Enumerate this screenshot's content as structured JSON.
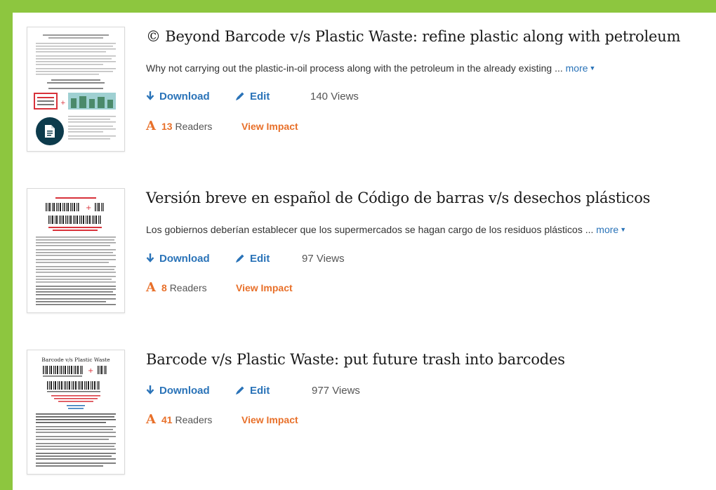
{
  "colors": {
    "background_green": "#8dc63f",
    "link_blue": "#2a73b8",
    "accent_orange": "#e8702a",
    "badge_navy": "#0d3b4c"
  },
  "papers": [
    {
      "title": "© Beyond Barcode v/s Plastic Waste: refine plastic along with petroleum",
      "summary": "Why not carrying out the plastic-in-oil process along with the petroleum in the already existing ...",
      "more_label": "more",
      "download_label": "Download",
      "edit_label": "Edit",
      "views_label": "140 Views",
      "readers_count": "13",
      "readers_label": "Readers",
      "impact_label": "View Impact",
      "thumbnail_icon": "document-icon"
    },
    {
      "title": "Versión breve en español de Código de barras v/s desechos plásticos",
      "summary": "Los gobiernos deberían establecer que los supermercados se hagan cargo de los residuos plásticos ...",
      "more_label": "more",
      "download_label": "Download",
      "edit_label": "Edit",
      "views_label": "97 Views",
      "readers_count": "8",
      "readers_label": "Readers",
      "impact_label": "View Impact"
    },
    {
      "title": "Barcode v/s Plastic Waste: put future trash into barcodes",
      "download_label": "Download",
      "edit_label": "Edit",
      "views_label": "977 Views",
      "readers_count": "41",
      "readers_label": "Readers",
      "impact_label": "View Impact",
      "thumbnail_heading": "Barcode v/s Plastic Waste"
    }
  ]
}
